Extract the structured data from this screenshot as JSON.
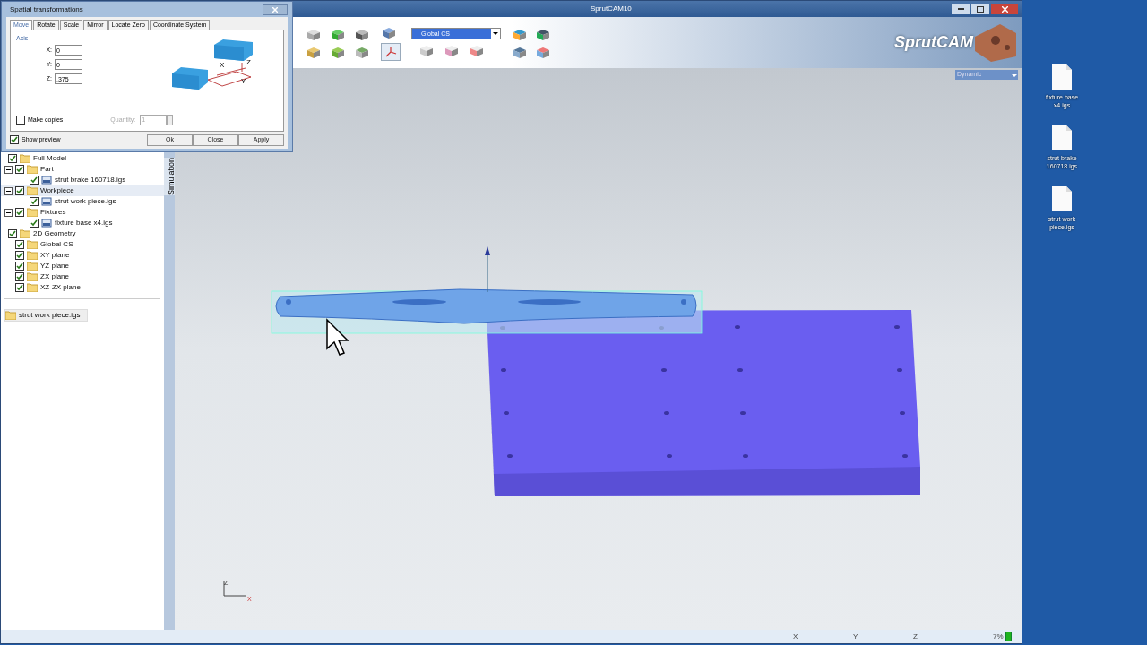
{
  "window": {
    "title": "SprutCAM10"
  },
  "coordinate_system": {
    "value": "Global CS"
  },
  "view_mode": {
    "value": "Dynamic"
  },
  "side_tabs": [
    {
      "label": "Simulation",
      "selected": false
    }
  ],
  "tree": [
    {
      "label": "Full Model",
      "checked": true,
      "selected": false,
      "kind": "folder",
      "children": [
        {
          "label": "Part",
          "checked": true,
          "selected": false,
          "kind": "folder",
          "expanded": true,
          "children": [
            {
              "label": "strut brake 160718.igs",
              "checked": true,
              "selected": false,
              "kind": "file"
            }
          ]
        },
        {
          "label": "Workpiece",
          "checked": true,
          "selected": true,
          "kind": "folder",
          "expanded": true,
          "children": [
            {
              "label": "strut work piece.igs",
              "checked": true,
              "selected": false,
              "kind": "file"
            }
          ]
        },
        {
          "label": "Fixtures",
          "checked": true,
          "selected": false,
          "kind": "folder",
          "expanded": true,
          "children": [
            {
              "label": "fixture base x4.igs",
              "checked": true,
              "selected": false,
              "kind": "file"
            }
          ]
        }
      ]
    },
    {
      "label": "2D Geometry",
      "checked": true,
      "selected": false,
      "kind": "folder",
      "children": [
        {
          "label": "Global CS",
          "checked": true,
          "selected": false,
          "kind": "folder"
        },
        {
          "label": "XY plane",
          "checked": true,
          "selected": false,
          "kind": "folder"
        },
        {
          "label": "YZ plane",
          "checked": true,
          "selected": false,
          "kind": "folder"
        },
        {
          "label": "ZX plane",
          "checked": true,
          "selected": false,
          "kind": "folder"
        },
        {
          "label": "XZ-ZX plane",
          "checked": true,
          "selected": false,
          "kind": "folder"
        }
      ]
    }
  ],
  "current_item": "strut work piece.igs",
  "status_bar": {
    "x": "X",
    "y": "Y",
    "z": "Z",
    "memory": "7%"
  },
  "desktop_icons": [
    {
      "label": "fixture base x4.igs"
    },
    {
      "label": "strut brake 160718.igs"
    },
    {
      "label": "strut work piece.igs"
    }
  ],
  "dialog": {
    "title": "Spatial transformations",
    "tabs": [
      {
        "label": "Move",
        "selected": true
      },
      {
        "label": "Rotate",
        "selected": false
      },
      {
        "label": "Scale",
        "selected": false
      },
      {
        "label": "Mirror",
        "selected": false
      },
      {
        "label": "Locate Zero",
        "selected": false
      },
      {
        "label": "Coordinate System",
        "selected": false
      }
    ],
    "group": "Axis",
    "fields": [
      {
        "label": "X:",
        "value": "0"
      },
      {
        "label": "Y:",
        "value": "0"
      },
      {
        "label": "Z:",
        "value": ".375"
      }
    ],
    "make_copies": {
      "label": "Make copies",
      "checked": false
    },
    "quantity": {
      "label": "Quantity:",
      "value": "1",
      "disabled": true
    },
    "show_preview": {
      "label": "Show preview",
      "checked": true
    },
    "buttons": [
      "Ok",
      "Close",
      "Apply"
    ],
    "diagram_labels": [
      "X",
      "Z",
      "Y"
    ]
  },
  "axis_labels": [
    "Z",
    "X"
  ],
  "logo": "SprutCAM"
}
